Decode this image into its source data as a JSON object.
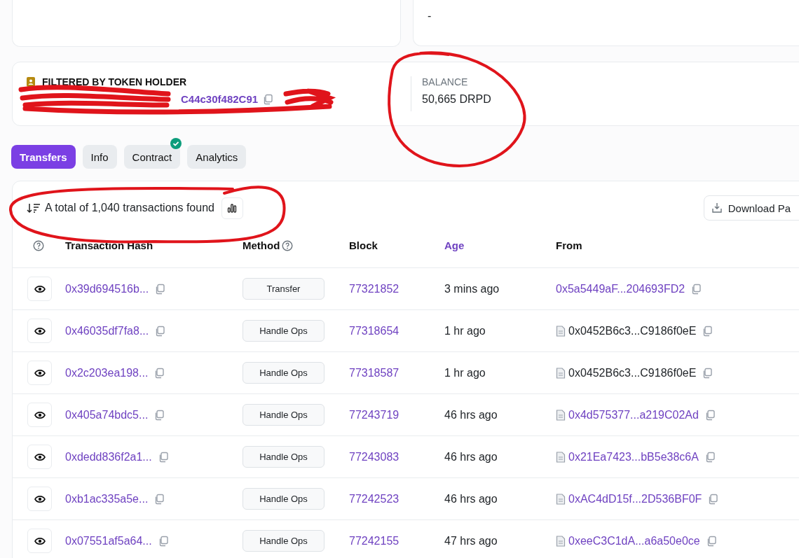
{
  "supply_card": {
    "value": "-"
  },
  "holder_filter": {
    "label": "FILTERED BY TOKEN HOLDER",
    "address": "C44c30f482C91",
    "balance_label": "BALANCE",
    "balance": "50,665 DRPD"
  },
  "tabs": [
    {
      "label": "Transfers",
      "selected": true,
      "verified": false
    },
    {
      "label": "Info",
      "selected": false,
      "verified": false
    },
    {
      "label": "Contract",
      "selected": false,
      "verified": true
    },
    {
      "label": "Analytics",
      "selected": false,
      "verified": false
    }
  ],
  "summary": "A total of 1,040 transactions found",
  "download_button": "Download Pa",
  "table": {
    "columns": [
      {
        "label": "Transaction Hash",
        "help": false,
        "sorted": false
      },
      {
        "label": "Method",
        "help": true,
        "sorted": false
      },
      {
        "label": "Block",
        "help": false,
        "sorted": false
      },
      {
        "label": "Age",
        "help": false,
        "sorted": true
      },
      {
        "label": "From",
        "help": false,
        "sorted": false
      }
    ],
    "rows": [
      {
        "hash": "0x39d694516b...",
        "method": "Transfer",
        "block": "77321852",
        "age": "3 mins ago",
        "from": {
          "text": "0x5a5449aF...204693FD2",
          "link": true,
          "contract": false
        }
      },
      {
        "hash": "0x46035df7fa8...",
        "method": "Handle Ops",
        "block": "77318654",
        "age": "1 hr ago",
        "from": {
          "text": "0x0452B6c3...C9186f0eE",
          "link": false,
          "contract": true
        }
      },
      {
        "hash": "0x2c203ea198...",
        "method": "Handle Ops",
        "block": "77318587",
        "age": "1 hr ago",
        "from": {
          "text": "0x0452B6c3...C9186f0eE",
          "link": false,
          "contract": true
        }
      },
      {
        "hash": "0x405a74bdc5...",
        "method": "Handle Ops",
        "block": "77243719",
        "age": "46 hrs ago",
        "from": {
          "text": "0x4d575377...a219C02Ad",
          "link": true,
          "contract": true
        }
      },
      {
        "hash": "0xdedd836f2a1...",
        "method": "Handle Ops",
        "block": "77243083",
        "age": "46 hrs ago",
        "from": {
          "text": "0x21Ea7423...bB5e38c6A",
          "link": true,
          "contract": true
        }
      },
      {
        "hash": "0xb1ac335a5e...",
        "method": "Handle Ops",
        "block": "77242523",
        "age": "46 hrs ago",
        "from": {
          "text": "0xAC4dD15f...2D536BF0F",
          "link": true,
          "contract": true
        }
      },
      {
        "hash": "0x07551af5a64...",
        "method": "Handle Ops",
        "block": "77242155",
        "age": "47 hrs ago",
        "from": {
          "text": "0xeeC3C1dA...a6a50e0ce",
          "link": true,
          "contract": true
        }
      }
    ]
  }
}
